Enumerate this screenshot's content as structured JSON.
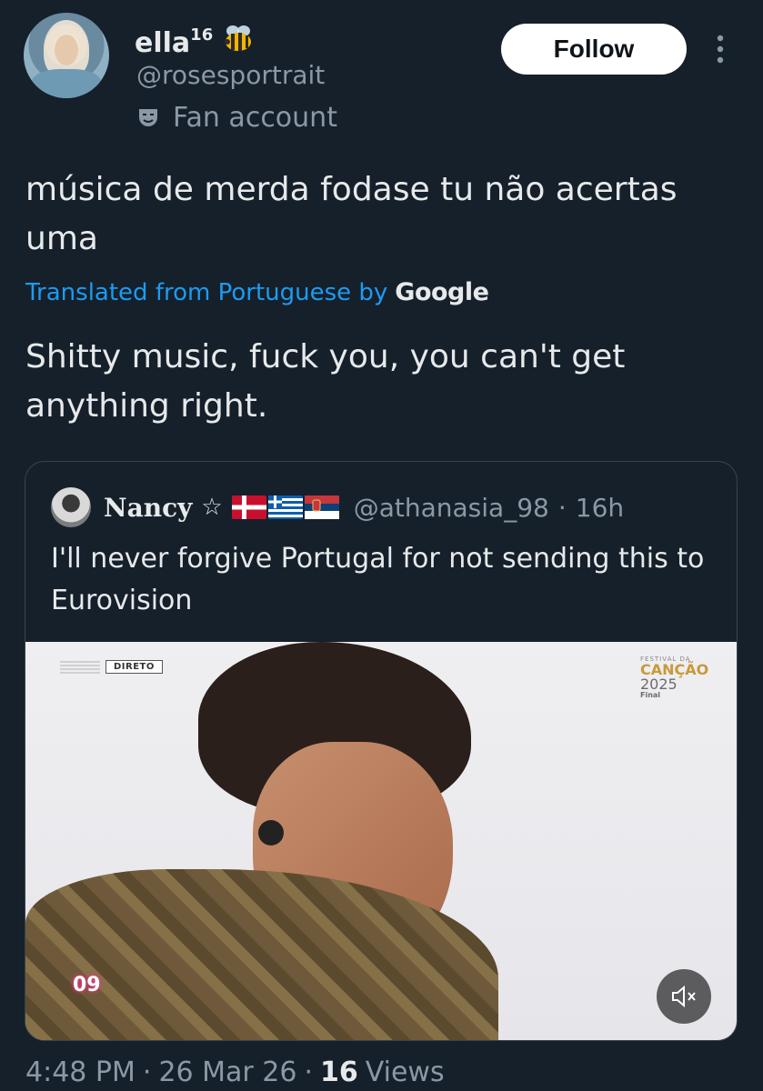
{
  "author": {
    "display_name": "ella",
    "name_superscript": "16",
    "name_emoji_icon": "bee-icon",
    "handle": "@rosesportrait",
    "label_icon": "theater-mask-icon",
    "label": "Fan account",
    "follow_label": "Follow"
  },
  "tweet": {
    "text": "música de merda fodase tu não acertas uma",
    "translated_prefix": "Translated from Portuguese by",
    "translated_provider": "Google",
    "translation": "Shitty music, fuck you, you can't get anything right."
  },
  "quoted": {
    "name": "Nancy",
    "star": "☆",
    "flags": [
      "denmark-flag-icon",
      "greece-flag-icon",
      "serbia-flag-icon"
    ],
    "handle": "@athanasia_98",
    "separator": "·",
    "time": "16h",
    "text": "I'll never forgive Portugal for not sending this to Eurovision",
    "media": {
      "live_tag": "DIRETO",
      "festival_line1": "FESTIVAL DA",
      "festival_line2": "CANÇÃO",
      "festival_line3": "2025",
      "festival_line4": "Final",
      "channel_number": "09",
      "mute_icon": "speaker-muted-icon"
    }
  },
  "meta": {
    "time": "4:48 PM",
    "sep1": "·",
    "date": "26 Mar 26",
    "sep2": "·",
    "views_count": "16",
    "views_label": "Views"
  },
  "colors": {
    "background": "#15202b",
    "link": "#1d9bf0",
    "muted": "#8b98a5",
    "text": "#e7e9ea"
  }
}
